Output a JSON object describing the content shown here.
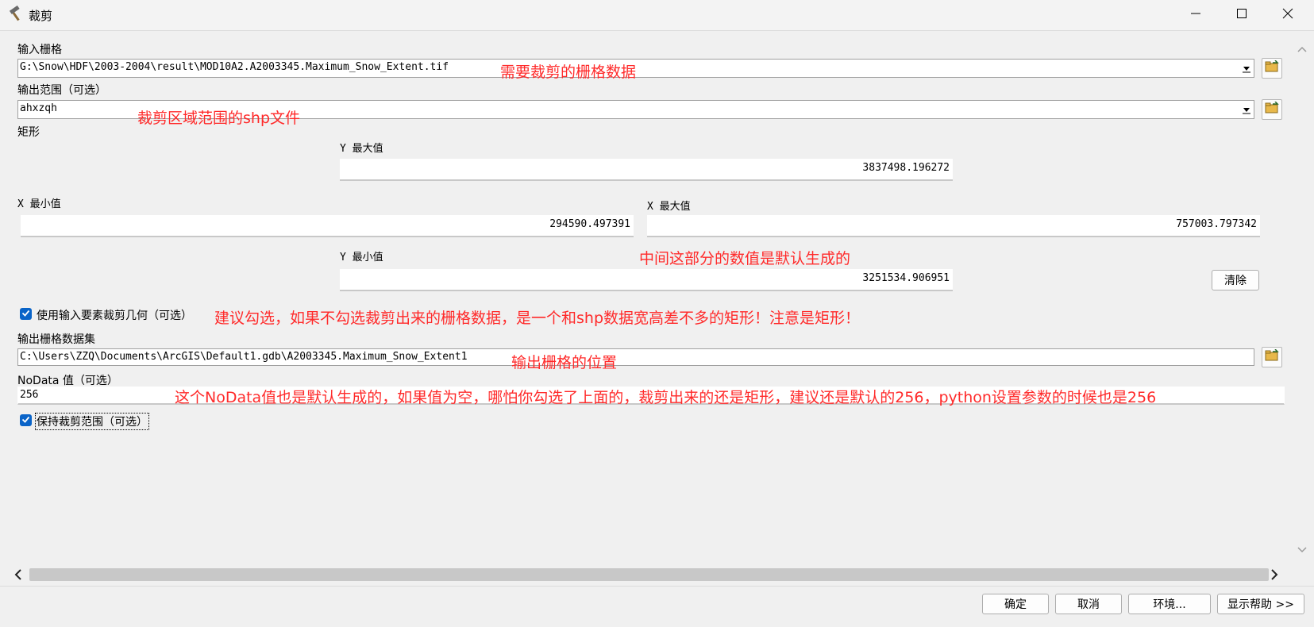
{
  "window": {
    "title": "裁剪",
    "icon": "hammer-icon",
    "minimize": "minimize-icon",
    "maximize": "maximize-icon",
    "close": "close-icon"
  },
  "form": {
    "input_raster": {
      "label": "输入栅格",
      "value": "G:\\Snow\\HDF\\2003-2004\\result\\MOD10A2.A2003345.Maximum_Snow_Extent.tif"
    },
    "output_extent": {
      "label": "输出范围（可选）",
      "value": "ahxzqh"
    },
    "rectangle": {
      "label": "矩形",
      "ymax_label": "Y 最大值",
      "ymax": "3837498.196272",
      "xmin_label": "X 最小值",
      "xmin": "294590.497391",
      "xmax_label": "X 最大值",
      "xmax": "757003.797342",
      "ymin_label": "Y 最小值",
      "ymin": "3251534.906951",
      "clear_label": "清除"
    },
    "use_input_geometry": {
      "label": "使用输入要素裁剪几何（可选）",
      "checked": true
    },
    "output_raster": {
      "label": "输出栅格数据集",
      "value": "C:\\Users\\ZZQ\\Documents\\ArcGIS\\Default1.gdb\\A2003345.Maximum_Snow_Extent1"
    },
    "nodata": {
      "label": "NoData 值（可选）",
      "value": "256"
    },
    "maintain_extent": {
      "label": "保持裁剪范围（可选）",
      "checked": true
    }
  },
  "annotations": {
    "a1": "需要裁剪的栅格数据",
    "a2": "裁剪区域范围的shp文件",
    "a3": "中间这部分的数值是默认生成的",
    "a4": "建议勾选，如果不勾选裁剪出来的栅格数据，是一个和shp数据宽高差不多的矩形！注意是矩形！",
    "a5": "输出栅格的位置",
    "a6": "这个NoData值也是默认生成的，如果值为空，哪怕你勾选了上面的，裁剪出来的还是矩形，建议还是默认的256，python设置参数的时候也是256"
  },
  "buttons": {
    "ok": "确定",
    "cancel": "取消",
    "env": "环境...",
    "help": "显示帮助 >>"
  },
  "colors": {
    "annotation": "#ff2a2a",
    "checkbox": "#0a64c8"
  }
}
